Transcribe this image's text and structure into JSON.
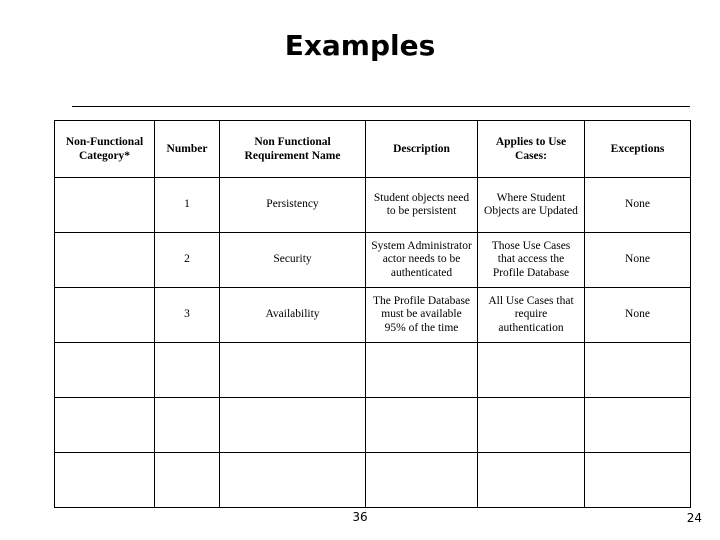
{
  "slide": {
    "title": "Examples",
    "footer_page_label": "36",
    "slide_number": "24"
  },
  "table": {
    "headers": [
      "Non-Functional Category*",
      "Number",
      "Non Functional Requirement Name",
      "Description",
      "Applies to Use Cases:",
      "Exceptions"
    ],
    "rows": [
      {
        "category": "",
        "number": "1",
        "name": "Persistency",
        "description": "Student objects need to be persistent",
        "applies_to": "Where Student Objects are Updated",
        "exceptions": "None"
      },
      {
        "category": "",
        "number": "2",
        "name": "Security",
        "description": "System Administrator actor needs to be authenticated",
        "applies_to": "Those Use Cases that access the Profile Database",
        "exceptions": "None"
      },
      {
        "category": "",
        "number": "3",
        "name": "Availability",
        "description": "The Profile Database must be available 95% of the time",
        "applies_to": "All Use Cases that require authentication",
        "exceptions": "None"
      },
      {
        "category": "",
        "number": "",
        "name": "",
        "description": "",
        "applies_to": "",
        "exceptions": ""
      },
      {
        "category": "",
        "number": "",
        "name": "",
        "description": "",
        "applies_to": "",
        "exceptions": ""
      },
      {
        "category": "",
        "number": "",
        "name": "",
        "description": "",
        "applies_to": "",
        "exceptions": ""
      }
    ]
  },
  "colors": {
    "background": "#ffffff",
    "text": "#000000",
    "border": "#000000"
  }
}
